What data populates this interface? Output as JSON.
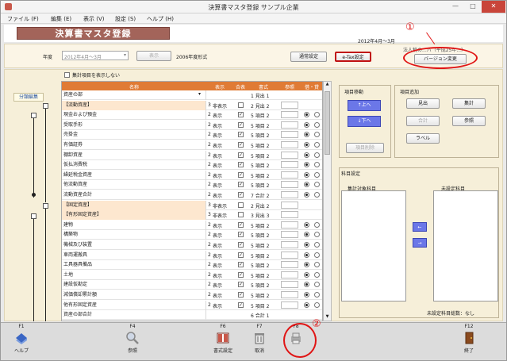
{
  "window": {
    "title": "決算書マスタ登録 サンプル企業",
    "min": "—",
    "max": "□",
    "close": "✕"
  },
  "menu": [
    "ファイル (F)",
    "編集 (E)",
    "表示 (V)",
    "設定 (S)",
    "ヘルプ (H)"
  ],
  "header": {
    "banner": "決算書マスタ登録",
    "date": "2012年4月～3月"
  },
  "toolbar": {
    "year_label": "年度",
    "year_value": "2012年4月～3月",
    "display_btn": "表示",
    "format_label": "2006年度形式",
    "normal_btn": "通常設定",
    "etax_btn": "e-Tax設定",
    "corp_label": "法人税の...バ（平成25年...）",
    "version_btn": "バージョン変更"
  },
  "content": {
    "hide_total": "集計項目を表示しない",
    "tree_edit": "分類編集"
  },
  "table": {
    "headers": [
      "名称",
      "表示",
      "合表",
      "書式",
      "参照",
      "借・貸"
    ],
    "rows": [
      {
        "name": "資産の部",
        "lv": "",
        "dp": "",
        "ck": "",
        "fm": "1 見出 1",
        "sec": false,
        "radio": 0
      },
      {
        "name": "【流動資産】",
        "lv": "3",
        "dp": "非表示",
        "ck": "",
        "fm": "2 見出 2",
        "sec": true,
        "radio": 0
      },
      {
        "name": "現金および預金",
        "lv": "2",
        "dp": "表示",
        "ck": "✓",
        "fm": "5 項目 2",
        "sec": false,
        "radio": 1
      },
      {
        "name": "受取手形",
        "lv": "2",
        "dp": "表示",
        "ck": "✓",
        "fm": "5 項目 2",
        "sec": false,
        "radio": 1
      },
      {
        "name": "売掛金",
        "lv": "2",
        "dp": "表示",
        "ck": "✓",
        "fm": "5 項目 2",
        "sec": false,
        "radio": 1
      },
      {
        "name": "有価証券",
        "lv": "2",
        "dp": "表示",
        "ck": "✓",
        "fm": "5 項目 2",
        "sec": false,
        "radio": 1
      },
      {
        "name": "棚卸資産",
        "lv": "2",
        "dp": "表示",
        "ck": "✓",
        "fm": "5 項目 2",
        "sec": false,
        "radio": 1
      },
      {
        "name": "仮払消費税",
        "lv": "2",
        "dp": "表示",
        "ck": "✓",
        "fm": "5 項目 2",
        "sec": false,
        "radio": 1
      },
      {
        "name": "繰延税金資産",
        "lv": "2",
        "dp": "表示",
        "ck": "✓",
        "fm": "5 項目 2",
        "sec": false,
        "radio": 1
      },
      {
        "name": "他流動資産",
        "lv": "2",
        "dp": "表示",
        "ck": "✓",
        "fm": "5 項目 2",
        "sec": false,
        "radio": 1
      },
      {
        "name": "流動資産合計",
        "lv": "2",
        "dp": "表示",
        "ck": "✓",
        "fm": "7 合計 2",
        "sec": false,
        "radio": 1
      },
      {
        "name": "【固定資産】",
        "lv": "3",
        "dp": "非表示",
        "ck": "",
        "fm": "2 見出 2",
        "sec": true,
        "radio": 0
      },
      {
        "name": "【有形固定資産】",
        "lv": "3",
        "dp": "非表示",
        "ck": "",
        "fm": "3 見出 3",
        "sec": true,
        "radio": 0
      },
      {
        "name": "建物",
        "lv": "2",
        "dp": "表示",
        "ck": "✓",
        "fm": "5 項目 2",
        "sec": false,
        "radio": 1
      },
      {
        "name": "構築物",
        "lv": "2",
        "dp": "表示",
        "ck": "✓",
        "fm": "5 項目 2",
        "sec": false,
        "radio": 1
      },
      {
        "name": "機械及び装置",
        "lv": "2",
        "dp": "表示",
        "ck": "✓",
        "fm": "5 項目 2",
        "sec": false,
        "radio": 1
      },
      {
        "name": "車両運搬具",
        "lv": "2",
        "dp": "表示",
        "ck": "✓",
        "fm": "5 項目 2",
        "sec": false,
        "radio": 1
      },
      {
        "name": "工具器具備品",
        "lv": "2",
        "dp": "表示",
        "ck": "✓",
        "fm": "5 項目 2",
        "sec": false,
        "radio": 1
      },
      {
        "name": "土地",
        "lv": "2",
        "dp": "表示",
        "ck": "✓",
        "fm": "5 項目 2",
        "sec": false,
        "radio": 1
      },
      {
        "name": "建設仮勘定",
        "lv": "2",
        "dp": "表示",
        "ck": "✓",
        "fm": "5 項目 2",
        "sec": false,
        "radio": 1
      },
      {
        "name": "減価償却累計額",
        "lv": "2",
        "dp": "表示",
        "ck": "✓",
        "fm": "5 項目 2",
        "sec": false,
        "radio": 1
      },
      {
        "name": "他有形固定資産",
        "lv": "2",
        "dp": "表示",
        "ck": "✓",
        "fm": "5 項目 2",
        "sec": false,
        "radio": 1
      },
      {
        "name": "資産の部合計",
        "lv": "",
        "dp": "",
        "ck": "",
        "fm": "6 合計 1",
        "sec": false,
        "radio": 0
      }
    ]
  },
  "move_panel": {
    "title": "項目移動",
    "up": "↑上へ",
    "down": "↓下へ",
    "delete": "項目削除"
  },
  "add_panel": {
    "title": "項目追加",
    "heading": "見出",
    "total": "集計",
    "sum": "合計",
    "ref": "参照",
    "label": "ラベル"
  },
  "setting_panel": {
    "title": "科目設定",
    "left": "集計対象科目",
    "right": "未設定科目",
    "count": "未設定科目総数：なし",
    "to_left": "←",
    "to_right": "→"
  },
  "footer": [
    {
      "key": "F1",
      "label": "ヘルプ",
      "icon": "help-book-icon"
    },
    {
      "key": "F4",
      "label": "参照",
      "icon": "magnifier-icon"
    },
    {
      "key": "F6",
      "label": "書式設定",
      "icon": "format-book-icon"
    },
    {
      "key": "F7",
      "label": "取消",
      "icon": "trash-icon"
    },
    {
      "key": "F8",
      "label": "",
      "icon": "printer-icon"
    },
    {
      "key": "F12",
      "label": "終了",
      "icon": "exit-door-icon"
    }
  ],
  "callouts": {
    "c1": "①",
    "c2": "②"
  }
}
